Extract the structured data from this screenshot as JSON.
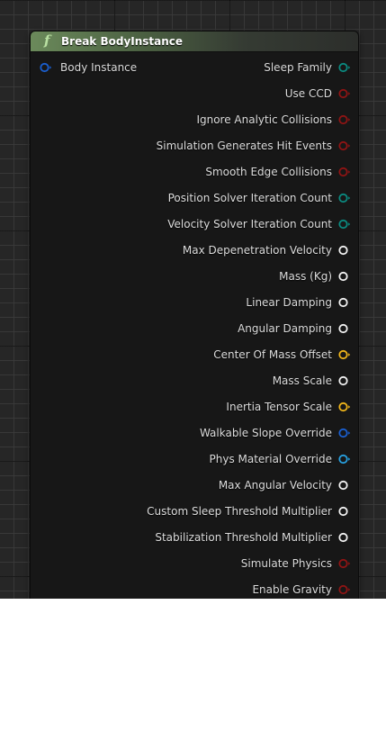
{
  "node": {
    "title": "Break BodyInstance",
    "icon": "function-icon",
    "header_color": "#6b8a5b",
    "input_pins": [
      {
        "label": "Body Instance",
        "color": "#1a5fd0",
        "type": "struct"
      }
    ],
    "output_pins": [
      {
        "label": "Sleep Family",
        "color": "#0b8a80",
        "type": "enum"
      },
      {
        "label": "Use CCD",
        "color": "#8f1414",
        "type": "bool"
      },
      {
        "label": "Ignore Analytic Collisions",
        "color": "#8f1414",
        "type": "bool"
      },
      {
        "label": "Simulation Generates Hit Events",
        "color": "#8f1414",
        "type": "bool"
      },
      {
        "label": "Smooth Edge Collisions",
        "color": "#8f1414",
        "type": "bool"
      },
      {
        "label": "Position Solver Iteration Count",
        "color": "#0b8a80",
        "type": "byte"
      },
      {
        "label": "Velocity Solver Iteration Count",
        "color": "#0b8a80",
        "type": "byte"
      },
      {
        "label": "Max Depenetration Velocity",
        "color": "#f2f2f2",
        "type": "float"
      },
      {
        "label": "Mass (Kg)",
        "color": "#f2f2f2",
        "type": "float"
      },
      {
        "label": "Linear Damping",
        "color": "#f2f2f2",
        "type": "float"
      },
      {
        "label": "Angular Damping",
        "color": "#f2f2f2",
        "type": "float"
      },
      {
        "label": "Center Of Mass Offset",
        "color": "#f0b51a",
        "type": "vector"
      },
      {
        "label": "Mass Scale",
        "color": "#f2f2f2",
        "type": "float"
      },
      {
        "label": "Inertia Tensor Scale",
        "color": "#f0b51a",
        "type": "vector"
      },
      {
        "label": "Walkable Slope Override",
        "color": "#1a5fd0",
        "type": "struct"
      },
      {
        "label": "Phys Material Override",
        "color": "#27a0e0",
        "type": "object"
      },
      {
        "label": "Max Angular Velocity",
        "color": "#f2f2f2",
        "type": "float"
      },
      {
        "label": "Custom Sleep Threshold Multiplier",
        "color": "#f2f2f2",
        "type": "float"
      },
      {
        "label": "Stabilization Threshold Multiplier",
        "color": "#f2f2f2",
        "type": "float"
      },
      {
        "label": "Simulate Physics",
        "color": "#8f1414",
        "type": "bool"
      },
      {
        "label": "Enable Gravity",
        "color": "#8f1414",
        "type": "bool"
      }
    ]
  }
}
